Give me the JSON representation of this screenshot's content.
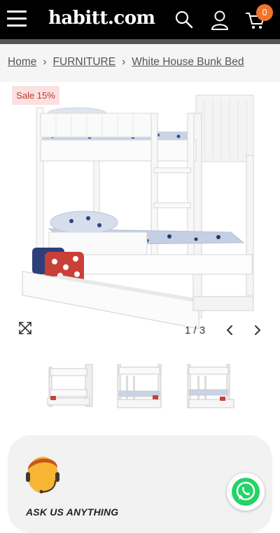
{
  "header": {
    "logo": "habitt.com",
    "cart_count": "0",
    "icons": [
      "menu-icon",
      "search-icon",
      "user-icon",
      "cart-icon"
    ]
  },
  "breadcrumb": {
    "items": [
      "Home",
      "FURNITURE",
      "White House Bunk Bed"
    ]
  },
  "product": {
    "sale_badge": "Sale 15%",
    "image_pager": "1 / 3"
  },
  "support": {
    "ask_label": "ASK US ANYTHING"
  },
  "colors": {
    "header_bg": "#000000",
    "cart_badge": "#f2752b",
    "sale_badge_bg": "#fbe0e0",
    "sale_badge_text": "#c0392b",
    "whatsapp": "#25d366"
  }
}
